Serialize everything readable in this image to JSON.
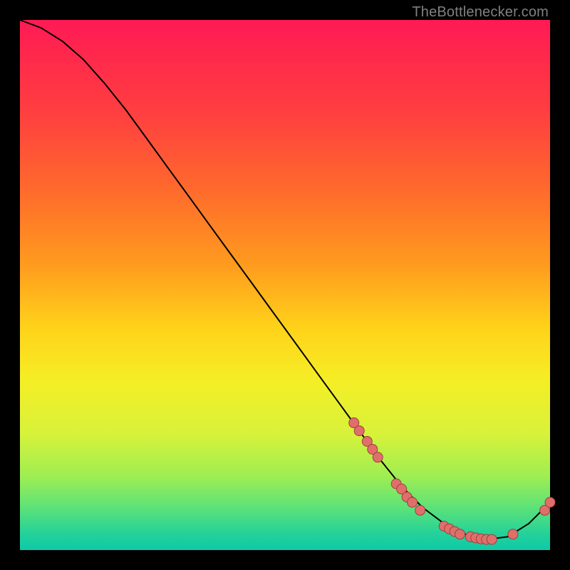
{
  "attribution": "TheBottlenecker.com",
  "colors": {
    "dot_fill": "#e06f6c",
    "dot_stroke": "#9e3f3c",
    "curve": "#000000"
  },
  "chart_data": {
    "type": "line",
    "title": "",
    "xlabel": "",
    "ylabel": "",
    "xlim": [
      0,
      100
    ],
    "ylim": [
      0,
      100
    ],
    "grid": false,
    "legend": false,
    "series": [
      {
        "name": "bottleneck-curve",
        "x": [
          0,
          4,
          8,
          12,
          16,
          20,
          24,
          28,
          32,
          36,
          40,
          44,
          48,
          52,
          56,
          60,
          64,
          68,
          72,
          76,
          80,
          84,
          88,
          92,
          96,
          100
        ],
        "y": [
          100,
          98.5,
          96,
          92.5,
          88,
          83,
          77.5,
          72,
          66.5,
          61,
          55.5,
          50,
          44.5,
          39,
          33.5,
          28,
          22.5,
          17,
          12,
          8,
          5,
          3,
          2,
          2.5,
          5,
          9
        ]
      }
    ],
    "markers": [
      {
        "x": 63,
        "y": 24
      },
      {
        "x": 64,
        "y": 22.5
      },
      {
        "x": 65.5,
        "y": 20.5
      },
      {
        "x": 66.5,
        "y": 19
      },
      {
        "x": 67.5,
        "y": 17.5
      },
      {
        "x": 71,
        "y": 12.5
      },
      {
        "x": 72,
        "y": 11.5
      },
      {
        "x": 73,
        "y": 10
      },
      {
        "x": 74,
        "y": 9
      },
      {
        "x": 75.5,
        "y": 7.5
      },
      {
        "x": 80,
        "y": 4.5
      },
      {
        "x": 81,
        "y": 4
      },
      {
        "x": 82,
        "y": 3.5
      },
      {
        "x": 83,
        "y": 3
      },
      {
        "x": 85,
        "y": 2.5
      },
      {
        "x": 86,
        "y": 2.3
      },
      {
        "x": 87,
        "y": 2.1
      },
      {
        "x": 88,
        "y": 2
      },
      {
        "x": 89,
        "y": 2
      },
      {
        "x": 93,
        "y": 3
      },
      {
        "x": 99,
        "y": 7.5
      },
      {
        "x": 100,
        "y": 9
      }
    ]
  }
}
